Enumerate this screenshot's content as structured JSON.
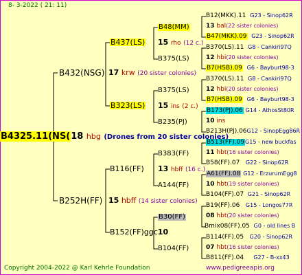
{
  "header_date": "8-  3-2022 (  21:  11)",
  "footer_left": "Copyright 2004-2022 @ Karl Kehrle Foundation",
  "footer_right": "www.pedigreeapis.org",
  "root": {
    "id": "B4325.11(NS(",
    "num": "18",
    "code": "hbg",
    "note": "(Drones from 20 sister colonies)"
  },
  "gen1": [
    {
      "id": "B432(NSG)",
      "num": "17",
      "code": "krw",
      "note": "(20 sister colonies)"
    },
    {
      "id": "B252H(FF)",
      "num": "15",
      "code": "hbff",
      "note": "(14 sister colonies)"
    }
  ],
  "gen2": [
    {
      "id": "B437(LS)",
      "num": "15",
      "code": "rho",
      "note": "(12 c.)"
    },
    {
      "id": "B323(LS)",
      "num": "15",
      "code": "ins",
      "note": "(2 c.)"
    },
    {
      "id": "B116(FF)",
      "num": "13",
      "code": "hbff",
      "note": "(16 c.)"
    },
    {
      "id": "B152(FF)ggc",
      "num": "10",
      "code": "",
      "note": ""
    }
  ],
  "gen3": [
    "B48(MM)",
    "B375(LS)",
    "B375(LS)",
    "B235(PJ)",
    "B383(FF)",
    "A144(FF)",
    "B30(FF)",
    "B104(FF)"
  ],
  "gen4": [
    {
      "a": "B12(MKK).11",
      "a_loc": "G23 - Sinop62R",
      "mid_num": "13",
      "mid_code": "bal",
      "mid_note": "(22 sister colonies)",
      "b": "B47(MKK).09",
      "b_loc": "G23 - Sinop62R"
    },
    {
      "a": "B370(LS).11",
      "a_loc": "G8 - Cankiri97Q",
      "mid_num": "12",
      "mid_code": "hbi",
      "mid_note": "(20 sister colonies)",
      "b": "B7(HSB).09",
      "b_loc": "G6 - Bayburt98-3"
    },
    {
      "a": "B370(LS).11",
      "a_loc": "G8 - Cankiri97Q",
      "mid_num": "12",
      "mid_code": "hbi",
      "mid_note": "(20 sister colonies)",
      "b": "B7(HSB).09",
      "b_loc": "G6 - Bayburt98-3"
    },
    {
      "a": "B173(PJ).06",
      "a_loc": "G14 - AthosSt80R",
      "mid_num": "10",
      "mid_code": "ins",
      "mid_note": "",
      "b": "B213H(PJ).06",
      "b_loc": "G12 - SinopEgg86R"
    },
    {
      "a": "B513(FF).09",
      "a_loc": "G15 - new buckfas",
      "mid_num": "11",
      "mid_code": "hbt",
      "mid_note": "(16 sister colonies)",
      "b": "B58(FF).07",
      "b_loc": "G22 - Sinop62R"
    },
    {
      "a": "A61(FF).08",
      "a_loc": "G12 - ErzurumEgg8",
      "mid_num": "10",
      "mid_code": "hbt",
      "mid_note": "(19 sister colonies)",
      "b": "B104(FF).07",
      "b_loc": "G21 - Sinop62R"
    },
    {
      "a": "B19(FF).06",
      "a_loc": "G15 - Longos77R",
      "mid_num": "08",
      "mid_code": "hbt",
      "mid_note": "(20 sister colonies)",
      "b": "Bmix08(FF).05",
      "b_loc": "G0 - old lines B"
    },
    {
      "a": "B114(FF).05",
      "a_loc": "G20 - Sinop62R",
      "mid_num": "07",
      "mid_code": "hbt",
      "mid_note": "(16 sister colonies)",
      "b": "B811(FF).04",
      "b_loc": "G27 - B-xx43"
    }
  ],
  "colors": {
    "yellow": "#ffff00",
    "cyan": "#00e0e0",
    "gray": "#b8b8b8"
  }
}
